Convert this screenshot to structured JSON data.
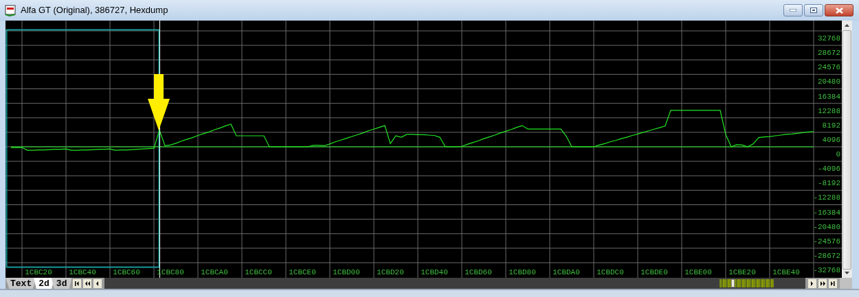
{
  "window": {
    "title": "Alfa GT (Original), 386727, Hexdump"
  },
  "chart_data": {
    "type": "line",
    "grid": true,
    "ylim": [
      -32768,
      32768
    ],
    "yticks": [
      32768,
      28672,
      24576,
      20480,
      16384,
      12288,
      8192,
      4096,
      0,
      -4096,
      -8192,
      -12288,
      -16384,
      -20480,
      -24576,
      -28672,
      -32768
    ],
    "categories": [
      null,
      null,
      null,
      null,
      null,
      "1CBC20",
      null,
      null,
      null,
      null,
      null,
      null,
      null,
      "1CBC40",
      null,
      null,
      null,
      null,
      null,
      null,
      null,
      "1CBC60",
      null,
      null,
      null,
      null,
      null,
      null,
      null,
      "1CBC80",
      null,
      null,
      null,
      null,
      null,
      null,
      null,
      "1CBCA0",
      null,
      null,
      null,
      null,
      null,
      null,
      null,
      "1CBCC0",
      null,
      null,
      null,
      null,
      null,
      null,
      null,
      "1CBCE0",
      null,
      null,
      null,
      null,
      null,
      null,
      null,
      "1CBD00",
      null,
      null,
      null,
      null,
      null,
      null,
      null,
      "1CBD20",
      null,
      null,
      null,
      null,
      null,
      null,
      null,
      "1CBD40",
      null,
      null,
      null,
      null,
      null,
      null,
      null,
      "1CBD60",
      null,
      null,
      null,
      null,
      null,
      null,
      null,
      "1CBD80",
      null,
      null,
      null,
      null,
      null,
      null,
      null,
      "1CBDA0",
      null,
      null,
      null,
      null,
      null,
      null,
      null,
      "1CBDC0",
      null,
      null,
      null,
      null,
      null,
      null,
      null,
      "1CBDE0",
      null,
      null,
      null,
      null,
      null,
      null,
      null,
      "1CBE00",
      null,
      null,
      null,
      null,
      null,
      null,
      null,
      "1CBE20",
      null,
      null,
      null,
      null,
      null,
      null,
      null,
      "1CBE40",
      null,
      null,
      null,
      null,
      null
    ],
    "series": [
      {
        "color": "#22e622",
        "values": [
          -200,
          -200,
          -200,
          -1000,
          -1000,
          -900,
          -900,
          -800,
          -700,
          -700,
          -600,
          -1000,
          -1000,
          -900,
          -900,
          -800,
          -700,
          -700,
          -600,
          -1000,
          -900,
          -900,
          -800,
          -700,
          -600,
          -500,
          -400,
          4700,
          300,
          500,
          1000,
          1600,
          2100,
          2600,
          3200,
          3700,
          4200,
          4800,
          5300,
          5900,
          6400,
          3100,
          3100,
          3100,
          3100,
          3100,
          3100,
          0,
          0,
          0,
          0,
          0,
          0,
          0,
          0,
          400,
          400,
          300,
          800,
          1400,
          1900,
          2400,
          2900,
          3400,
          3900,
          4500,
          5000,
          5500,
          6000,
          900,
          3100,
          2700,
          3500,
          3500,
          3400,
          3400,
          3300,
          3200,
          2700,
          0,
          0,
          0,
          100,
          700,
          1200,
          1700,
          2300,
          2800,
          3300,
          3900,
          4400,
          4900,
          5500,
          6000,
          5000,
          5000,
          5000,
          5000,
          5000,
          5000,
          5000,
          3000,
          0,
          0,
          0,
          0,
          0,
          500,
          900,
          1400,
          1800,
          2300,
          2700,
          3200,
          3600,
          4100,
          4500,
          5000,
          5400,
          5900,
          10300,
          10300,
          10300,
          10300,
          10300,
          10300,
          10300,
          10300,
          10300,
          10300,
          3500,
          0,
          600,
          500,
          0,
          800,
          2600,
          2800,
          2900,
          3100,
          3300,
          3500,
          3600,
          3800,
          4000,
          4200,
          4300
        ]
      },
      {
        "color": "#22e622",
        "values": [
          0,
          0,
          0,
          0,
          0,
          0,
          0,
          0,
          0,
          0,
          0,
          0,
          0,
          0,
          0,
          0,
          0,
          0,
          0,
          0,
          0,
          0,
          0,
          0,
          0,
          0,
          0,
          0,
          0,
          0,
          0,
          0,
          0,
          0,
          0,
          0,
          0,
          0,
          0,
          0,
          0,
          0,
          0,
          0,
          0,
          0,
          0,
          0,
          0,
          0,
          0,
          0,
          0,
          0,
          0,
          0,
          0,
          0,
          0,
          0,
          0,
          0,
          0,
          0,
          0,
          0,
          0,
          0,
          0,
          0,
          0,
          0,
          0,
          0,
          0,
          0,
          0,
          0,
          0,
          0,
          0,
          0,
          0,
          0,
          0,
          0,
          0,
          0,
          0,
          0,
          0,
          0,
          0,
          0,
          0,
          0,
          0,
          0,
          0,
          0,
          0,
          0,
          0,
          0,
          0,
          0,
          0,
          0,
          0,
          0,
          0,
          0,
          0,
          0,
          0,
          0,
          0,
          0,
          0,
          0,
          0,
          0,
          0,
          0,
          0,
          0,
          0,
          0,
          0,
          0,
          0,
          0,
          0,
          0,
          0,
          0,
          0,
          0,
          0,
          0,
          0,
          0,
          0,
          0,
          0,
          0,
          0
        ]
      }
    ]
  },
  "tabs": [
    {
      "label": "Text",
      "selected": false
    },
    {
      "label": "2d",
      "selected": true
    },
    {
      "label": "3d",
      "selected": false
    }
  ]
}
